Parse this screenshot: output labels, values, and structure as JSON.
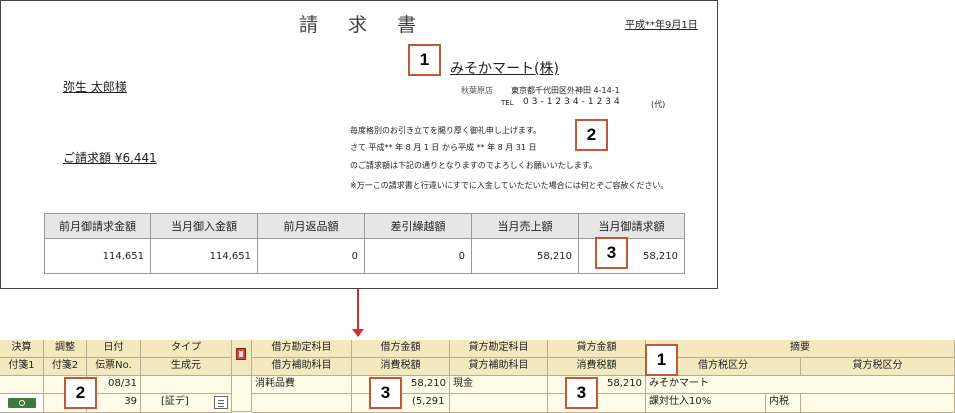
{
  "invoice": {
    "title": "請 求 書",
    "date": "平成**年9月1日",
    "vendor": {
      "name": "みそかマート(株)",
      "branch": "秋葉原店",
      "address": "東京都千代田区外神田 4-14-1",
      "tel_label": "TEL",
      "tel": "03-1234-1234",
      "tel_suffix": "(代)"
    },
    "customer": "弥生 太郎様",
    "billing_amount": "ご請求額 ¥6,441",
    "messages": [
      "毎度格別のお引き立てを賜り厚く御礼申し上げます。",
      "さて 平成** 年 8 月 1 日 から平成 ** 年 8 月 31 日",
      "のご請求額は下記の通りとなりますのでよろしくお願いいたします。",
      "※万一この請求書と行違いにすでに入金していただいた場合には何とぞご容赦ください。"
    ],
    "summary": {
      "headers": [
        "前月御請求金額",
        "当月御入金額",
        "前月返品額",
        "差引繰越額",
        "当月売上額",
        "当月御請求額"
      ],
      "values": [
        "114,651",
        "114,651",
        "0",
        "0",
        "58,210",
        "58,210"
      ]
    }
  },
  "badges": [
    "1",
    "2",
    "3"
  ],
  "journal": {
    "headers": {
      "kessan": "決算",
      "chosei": "調整",
      "hizuke": "日付",
      "type": "タイプ",
      "debit_account": "借方勘定科目",
      "debit_amount": "借方金額",
      "credit_account": "貸方勘定科目",
      "credit_amount": "貸方金額",
      "summary": "摘要",
      "tag1": "付箋1",
      "tag2": "付箋2",
      "slip_no": "伝票No.",
      "origin": "生成元",
      "debit_sub": "借方補助科目",
      "debit_tax": "消費税額",
      "credit_sub": "貸方補助科目",
      "credit_tax": "消費税額",
      "debit_tax_cat": "借方税区分",
      "credit_tax_cat": "貸方税区分"
    },
    "row": {
      "date": "08/31",
      "slip_no": "39",
      "origin": "[証デ]",
      "debit_account": "消耗品費",
      "debit_amount": "58,210",
      "debit_tax": "(5,291",
      "credit_account": "現金",
      "credit_amount": "58,210",
      "summary": "みそかマート",
      "debit_tax_cat": "課対仕入10%",
      "tax_type": "内税"
    }
  },
  "colors": {
    "badge_border": "#c0583a",
    "header_bg": "#f4e8bf",
    "arrow": "#d03030",
    "toggle": "#3d7a3d"
  },
  "icons": [
    "book-icon",
    "slip-icon",
    "toggle-switch"
  ]
}
